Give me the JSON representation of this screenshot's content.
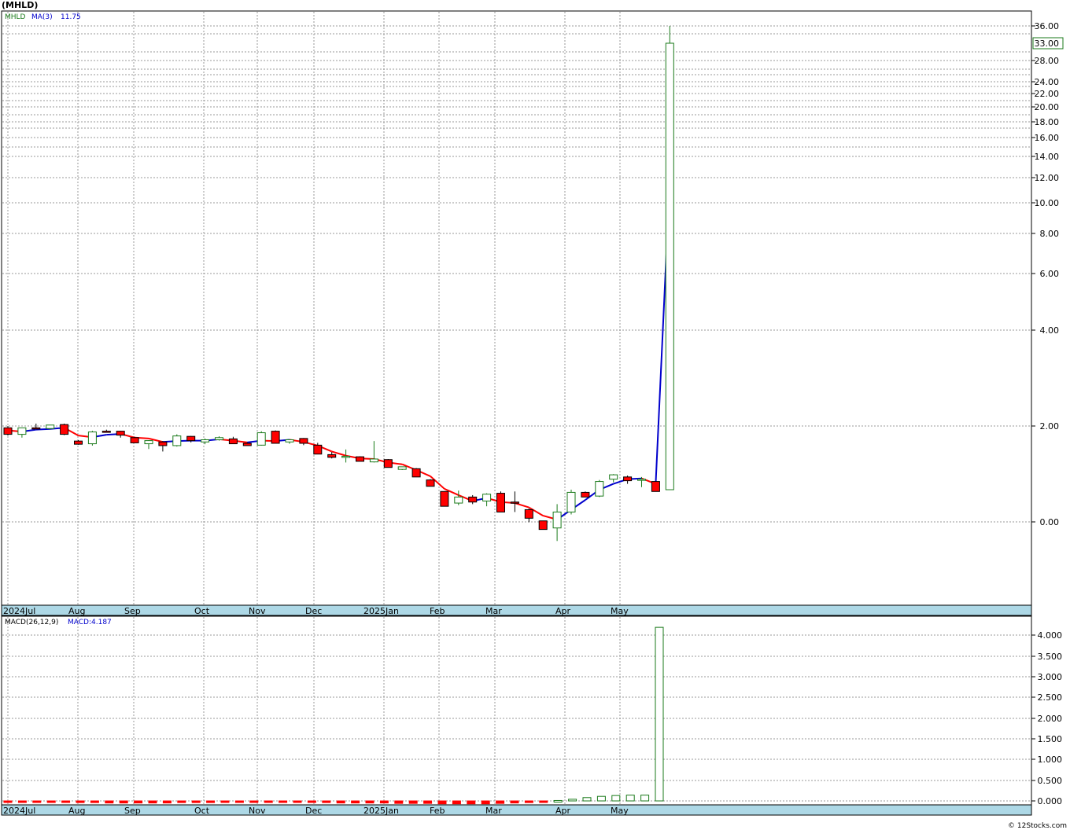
{
  "title": "(MHLD)",
  "footer": "© 12Stocks.com",
  "price_legend": {
    "symbol": "MHLD",
    "ma_label": "MA(3)",
    "ma_value": "11.75"
  },
  "macd_legend": {
    "label": "MACD(26,12,9)",
    "value_label": "MACD:4.187"
  },
  "colors": {
    "up": "#1a7a1a",
    "down": "#ff0000",
    "ma_up": "#0000cc",
    "ma_down": "#ff0000",
    "axis_band": "#add8e6",
    "grid": "#999999"
  },
  "chart_data": [
    {
      "type": "candlestick",
      "y_scale": "log",
      "y_ticks": [
        "0.00",
        "2.00",
        "4.00",
        "6.00",
        "8.00",
        "10.00",
        "12.00",
        "14.00",
        "16.00",
        "18.00",
        "20.00",
        "22.00",
        "24.00",
        "28.00",
        "33.00",
        "36.00"
      ],
      "last_price_label": "33.00",
      "x_labels": [
        "2024Jul",
        "Aug",
        "Sep",
        "Oct",
        "Nov",
        "Dec",
        "2025Jan",
        "Feb",
        "Mar",
        "Apr",
        "May"
      ],
      "candles": [
        {
          "o": 1.95,
          "h": 2.0,
          "l": 1.75,
          "c": 1.78
        },
        {
          "o": 1.78,
          "h": 1.95,
          "l": 1.7,
          "c": 1.95
        },
        {
          "o": 1.95,
          "h": 2.05,
          "l": 1.92,
          "c": 1.93
        },
        {
          "o": 1.93,
          "h": 2.02,
          "l": 1.9,
          "c": 2.02
        },
        {
          "o": 2.03,
          "h": 2.05,
          "l": 1.76,
          "c": 1.78
        },
        {
          "o": 1.62,
          "h": 1.64,
          "l": 1.54,
          "c": 1.55
        },
        {
          "o": 1.56,
          "h": 1.87,
          "l": 1.52,
          "c": 1.84
        },
        {
          "o": 1.86,
          "h": 1.9,
          "l": 1.83,
          "c": 1.85
        },
        {
          "o": 1.86,
          "h": 1.87,
          "l": 1.7,
          "c": 1.76
        },
        {
          "o": 1.7,
          "h": 1.72,
          "l": 1.58,
          "c": 1.58
        },
        {
          "o": 1.56,
          "h": 1.64,
          "l": 1.45,
          "c": 1.63
        },
        {
          "o": 1.6,
          "h": 1.62,
          "l": 1.4,
          "c": 1.52
        },
        {
          "o": 1.52,
          "h": 1.78,
          "l": 1.5,
          "c": 1.74
        },
        {
          "o": 1.73,
          "h": 1.74,
          "l": 1.59,
          "c": 1.63
        },
        {
          "o": 1.6,
          "h": 1.68,
          "l": 1.55,
          "c": 1.65
        },
        {
          "o": 1.65,
          "h": 1.73,
          "l": 1.63,
          "c": 1.7
        },
        {
          "o": 1.67,
          "h": 1.72,
          "l": 1.56,
          "c": 1.56
        },
        {
          "o": 1.57,
          "h": 1.59,
          "l": 1.52,
          "c": 1.52
        },
        {
          "o": 1.53,
          "h": 1.86,
          "l": 1.52,
          "c": 1.82
        },
        {
          "o": 1.86,
          "h": 1.88,
          "l": 1.57,
          "c": 1.57
        },
        {
          "o": 1.6,
          "h": 1.65,
          "l": 1.56,
          "c": 1.65
        },
        {
          "o": 1.68,
          "h": 1.69,
          "l": 1.53,
          "c": 1.57
        },
        {
          "o": 1.53,
          "h": 1.58,
          "l": 1.35,
          "c": 1.35
        },
        {
          "o": 1.34,
          "h": 1.39,
          "l": 1.27,
          "c": 1.29
        },
        {
          "o": 1.31,
          "h": 1.44,
          "l": 1.2,
          "c": 1.31
        },
        {
          "o": 1.3,
          "h": 1.31,
          "l": 1.22,
          "c": 1.22
        },
        {
          "o": 1.21,
          "h": 1.62,
          "l": 1.2,
          "c": 1.26
        },
        {
          "o": 1.25,
          "h": 1.26,
          "l": 1.12,
          "c": 1.12
        },
        {
          "o": 1.09,
          "h": 1.13,
          "l": 1.08,
          "c": 1.13
        },
        {
          "o": 1.1,
          "h": 1.11,
          "l": 0.98,
          "c": 0.98
        },
        {
          "o": 0.94,
          "h": 0.95,
          "l": 0.86,
          "c": 0.86
        },
        {
          "o": 0.8,
          "h": 0.8,
          "l": 0.65,
          "c": 0.65
        },
        {
          "o": 0.68,
          "h": 0.81,
          "l": 0.66,
          "c": 0.74
        },
        {
          "o": 0.74,
          "h": 0.76,
          "l": 0.67,
          "c": 0.69
        },
        {
          "o": 0.7,
          "h": 0.78,
          "l": 0.65,
          "c": 0.77
        },
        {
          "o": 0.78,
          "h": 0.8,
          "l": 0.6,
          "c": 0.6
        },
        {
          "o": 0.69,
          "h": 0.8,
          "l": 0.6,
          "c": 0.68
        },
        {
          "o": 0.62,
          "h": 0.63,
          "l": 0.52,
          "c": 0.55
        },
        {
          "o": 0.53,
          "h": 0.53,
          "l": 0.47,
          "c": 0.47
        },
        {
          "o": 0.48,
          "h": 0.67,
          "l": 0.4,
          "c": 0.6
        },
        {
          "o": 0.6,
          "h": 0.82,
          "l": 0.58,
          "c": 0.79
        },
        {
          "o": 0.79,
          "h": 0.8,
          "l": 0.74,
          "c": 0.74
        },
        {
          "o": 0.75,
          "h": 0.94,
          "l": 0.74,
          "c": 0.92
        },
        {
          "o": 0.95,
          "h": 1.02,
          "l": 0.91,
          "c": 1.01
        },
        {
          "o": 0.98,
          "h": 1.0,
          "l": 0.89,
          "c": 0.93
        },
        {
          "o": 0.95,
          "h": 0.98,
          "l": 0.85,
          "c": 0.95
        },
        {
          "o": 0.92,
          "h": 0.92,
          "l": 0.8,
          "c": 0.8
        },
        {
          "o": 0.82,
          "h": 36.0,
          "l": 0.82,
          "c": 33.0
        }
      ],
      "ma3": [
        1.88,
        1.85,
        1.9,
        1.92,
        1.95,
        1.75,
        1.71,
        1.77,
        1.79,
        1.7,
        1.68,
        1.6,
        1.62,
        1.63,
        1.63,
        1.66,
        1.63,
        1.59,
        1.63,
        1.62,
        1.65,
        1.6,
        1.52,
        1.4,
        1.32,
        1.27,
        1.26,
        1.2,
        1.17,
        1.08,
        0.99,
        0.83,
        0.76,
        0.7,
        0.73,
        0.69,
        0.68,
        0.64,
        0.57,
        0.54,
        0.62,
        0.71,
        0.82,
        0.89,
        0.95,
        0.96,
        0.89,
        11.75
      ]
    },
    {
      "type": "bar",
      "name": "MACD",
      "y_ticks": [
        "0.000",
        "0.500",
        "1.000",
        "1.500",
        "2.000",
        "2.500",
        "3.000",
        "3.500",
        "4.000"
      ],
      "x_labels": [
        "2024Jul",
        "Aug",
        "Sep",
        "Oct",
        "Nov",
        "Dec",
        "2025Jan",
        "Feb",
        "Mar",
        "Apr",
        "May"
      ],
      "values": [
        -0.02,
        -0.02,
        -0.02,
        -0.02,
        -0.03,
        -0.04,
        -0.04,
        -0.05,
        -0.05,
        -0.05,
        -0.05,
        -0.05,
        -0.04,
        -0.04,
        -0.04,
        -0.03,
        -0.02,
        -0.01,
        -0.01,
        -0.02,
        -0.02,
        -0.03,
        -0.04,
        -0.05,
        -0.05,
        -0.05,
        -0.05,
        -0.06,
        -0.06,
        -0.06,
        -0.07,
        -0.07,
        -0.07,
        -0.07,
        -0.06,
        -0.05,
        -0.04,
        -0.03,
        0.01,
        0.04,
        0.08,
        0.11,
        0.13,
        0.14,
        0.14,
        4.187
      ]
    }
  ]
}
